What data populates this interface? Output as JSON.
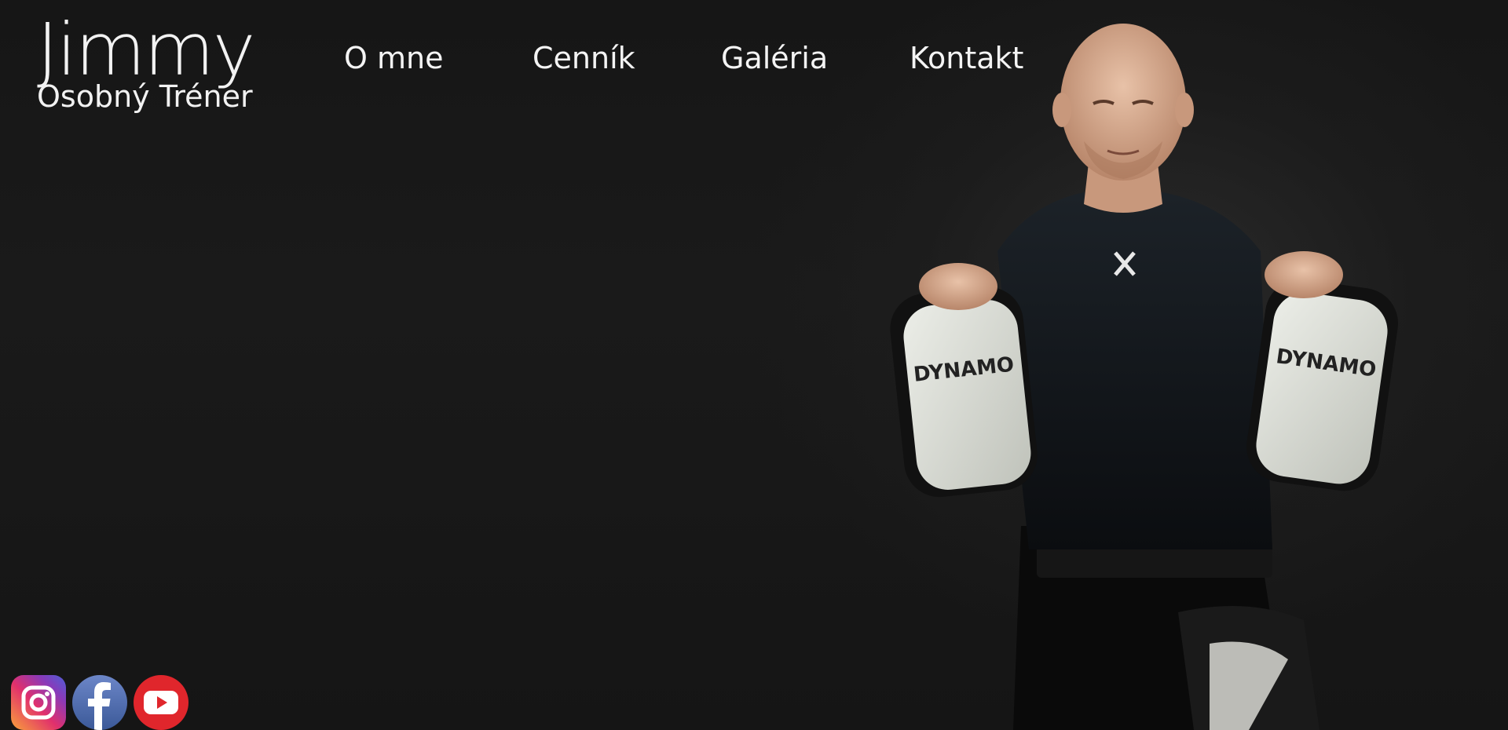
{
  "brand": {
    "name": "Jimmy",
    "subtitle": "Osobný Tréner"
  },
  "nav": {
    "items": [
      {
        "label": "O mne"
      },
      {
        "label": "Cenník"
      },
      {
        "label": "Galéria"
      },
      {
        "label": "Kontakt"
      }
    ]
  },
  "hero": {
    "pad_brand": "DYNAMO",
    "background_color": "#151515"
  },
  "socials": [
    {
      "name": "instagram",
      "icon": "instagram-icon"
    },
    {
      "name": "facebook",
      "icon": "facebook-icon"
    },
    {
      "name": "youtube",
      "icon": "youtube-icon"
    }
  ]
}
